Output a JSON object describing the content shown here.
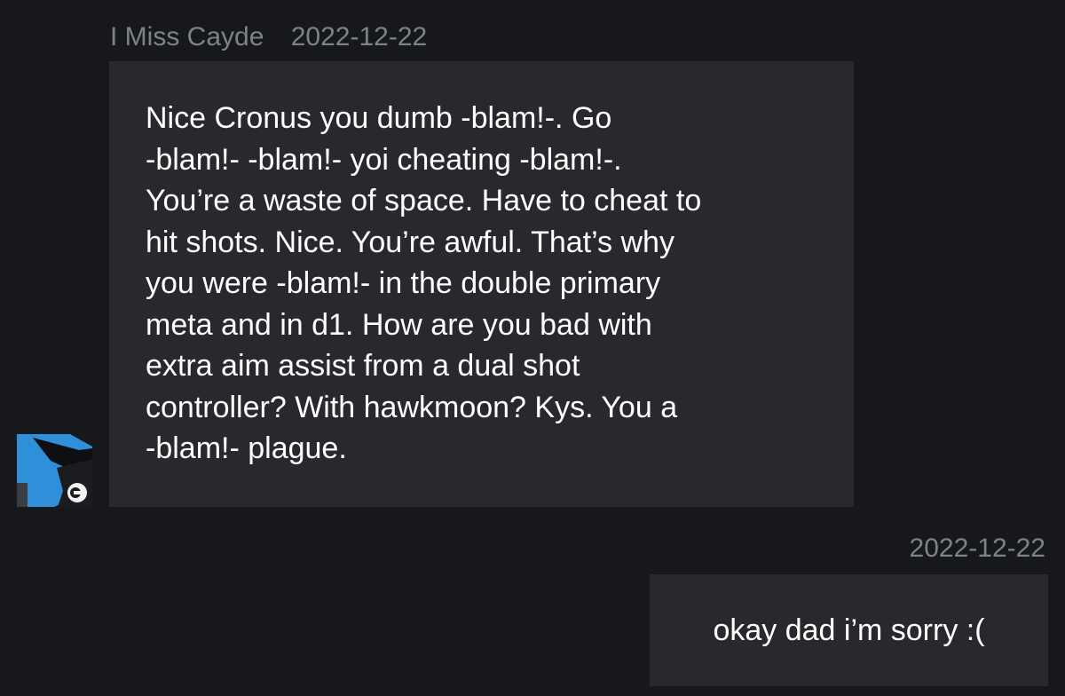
{
  "incoming": {
    "sender": "I Miss Cayde",
    "date": "2022-12-22",
    "avatar_icon": "wolf-emblem-icon",
    "message": "Nice Cronus you dumb -blam!-. Go\n-blam!- -blam!- yoi cheating -blam!-.\nYou’re a waste of space. Have to cheat to\nhit shots. Nice. You’re awful. That’s why\nyou were -blam!- in the double primary\nmeta and in d1. How are you bad with\nextra aim assist from a dual shot\ncontroller? With hawkmoon? Kys. You a\n-blam!- plague."
  },
  "outgoing": {
    "date": "2022-12-22",
    "message": "okay dad i’m sorry :("
  },
  "colors": {
    "background": "#16181c",
    "bubble": "#27292d",
    "meta_text": "#7e8287",
    "message_text": "#ffffff",
    "avatar_accent": "#2f8fd8"
  }
}
